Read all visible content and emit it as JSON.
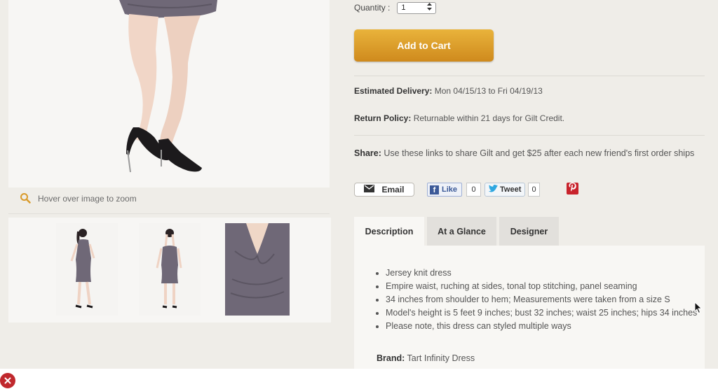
{
  "gallery": {
    "zoom_hint": "Hover over image to zoom"
  },
  "purchase": {
    "quantity_label": "Quantity :",
    "quantity_value": "1",
    "add_to_cart_label": "Add to Cart"
  },
  "delivery": {
    "label": "Estimated Delivery:",
    "value": "Mon 04/15/13 to Fri 04/19/13"
  },
  "return_policy": {
    "label": "Return Policy:",
    "value": "Returnable within 21 days for Gilt Credit."
  },
  "share": {
    "label": "Share:",
    "text": "Use these links to share Gilt and get $25 after each new friend's first order ships",
    "email_label": "Email",
    "like_label": "Like",
    "like_count": "0",
    "tweet_label": "Tweet",
    "tweet_count": "0"
  },
  "tabs": [
    {
      "label": "Description"
    },
    {
      "label": "At a Glance"
    },
    {
      "label": "Designer"
    }
  ],
  "description": {
    "items": [
      "Jersey knit dress",
      "Empire waist, ruching at sides, tonal top stitching, panel seaming",
      "34 inches from shoulder to hem; Measurements were taken from a size S",
      "Model's height is 5 feet 9 inches; bust 32 inches; waist 25 inches; hips 34 inches",
      "Please note, this dress can styled multiple ways"
    ],
    "brand_label": "Brand:",
    "brand_value": "Tart Infinity Dress"
  },
  "colors": {
    "accent": "#d99a2a",
    "background": "#efede8",
    "dress": "#6f6877"
  }
}
